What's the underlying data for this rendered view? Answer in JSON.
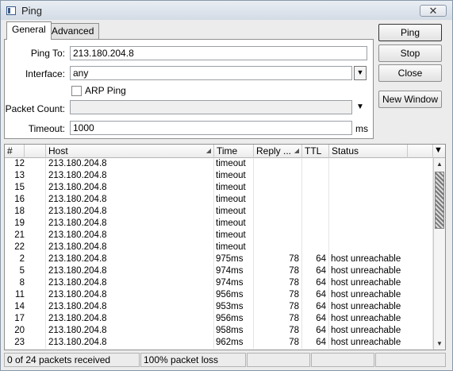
{
  "window": {
    "title": "Ping",
    "close_glyph": "✕"
  },
  "tabs": [
    {
      "label": "General",
      "active": true
    },
    {
      "label": "Advanced",
      "active": false
    }
  ],
  "form": {
    "ping_to_label": "Ping To:",
    "ping_to_value": "213.180.204.8",
    "interface_label": "Interface:",
    "interface_value": "any",
    "arp_ping_label": "ARP Ping",
    "arp_ping_checked": false,
    "packet_count_label": "Packet Count:",
    "packet_count_value": "",
    "timeout_label": "Timeout:",
    "timeout_value": "1000",
    "timeout_unit": "ms"
  },
  "buttons": {
    "ping": "Ping",
    "stop": "Stop",
    "close": "Close",
    "new_window": "New Window"
  },
  "table": {
    "columns": [
      "#",
      "Host",
      "Time",
      "Reply ...",
      "TTL",
      "Status"
    ],
    "rows": [
      {
        "num": "12",
        "host": "213.180.204.8",
        "time": "timeout",
        "reply": "",
        "ttl": "",
        "status": ""
      },
      {
        "num": "13",
        "host": "213.180.204.8",
        "time": "timeout",
        "reply": "",
        "ttl": "",
        "status": ""
      },
      {
        "num": "15",
        "host": "213.180.204.8",
        "time": "timeout",
        "reply": "",
        "ttl": "",
        "status": ""
      },
      {
        "num": "16",
        "host": "213.180.204.8",
        "time": "timeout",
        "reply": "",
        "ttl": "",
        "status": ""
      },
      {
        "num": "18",
        "host": "213.180.204.8",
        "time": "timeout",
        "reply": "",
        "ttl": "",
        "status": ""
      },
      {
        "num": "19",
        "host": "213.180.204.8",
        "time": "timeout",
        "reply": "",
        "ttl": "",
        "status": ""
      },
      {
        "num": "21",
        "host": "213.180.204.8",
        "time": "timeout",
        "reply": "",
        "ttl": "",
        "status": ""
      },
      {
        "num": "22",
        "host": "213.180.204.8",
        "time": "timeout",
        "reply": "",
        "ttl": "",
        "status": ""
      },
      {
        "num": "2",
        "host": "213.180.204.8",
        "time": "975ms",
        "reply": "78",
        "ttl": "64",
        "status": "host unreachable"
      },
      {
        "num": "5",
        "host": "213.180.204.8",
        "time": "974ms",
        "reply": "78",
        "ttl": "64",
        "status": "host unreachable"
      },
      {
        "num": "8",
        "host": "213.180.204.8",
        "time": "974ms",
        "reply": "78",
        "ttl": "64",
        "status": "host unreachable"
      },
      {
        "num": "11",
        "host": "213.180.204.8",
        "time": "956ms",
        "reply": "78",
        "ttl": "64",
        "status": "host unreachable"
      },
      {
        "num": "14",
        "host": "213.180.204.8",
        "time": "953ms",
        "reply": "78",
        "ttl": "64",
        "status": "host unreachable"
      },
      {
        "num": "17",
        "host": "213.180.204.8",
        "time": "956ms",
        "reply": "78",
        "ttl": "64",
        "status": "host unreachable"
      },
      {
        "num": "20",
        "host": "213.180.204.8",
        "time": "958ms",
        "reply": "78",
        "ttl": "64",
        "status": "host unreachable"
      },
      {
        "num": "23",
        "host": "213.180.204.8",
        "time": "962ms",
        "reply": "78",
        "ttl": "64",
        "status": "host unreachable"
      }
    ]
  },
  "status": {
    "received": "0 of 24 packets received",
    "loss": "100% packet loss"
  }
}
